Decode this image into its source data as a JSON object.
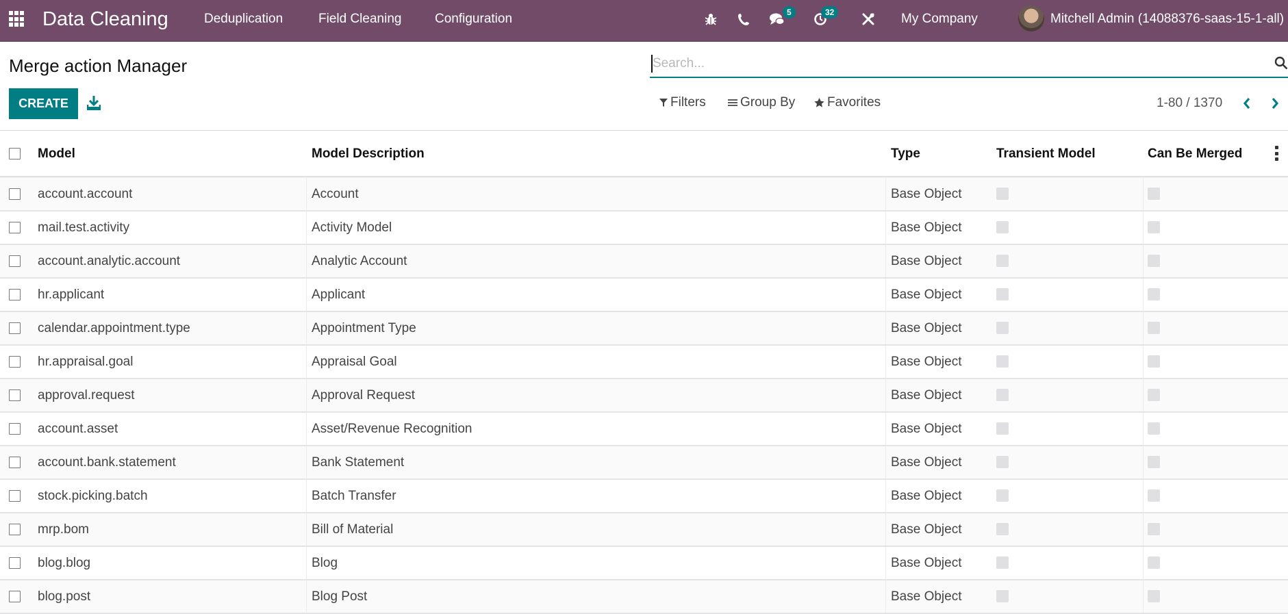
{
  "navbar": {
    "app_name": "Data Cleaning",
    "menu": [
      "Deduplication",
      "Field Cleaning",
      "Configuration"
    ],
    "icons": [
      "bug-icon",
      "phone-icon",
      "chat-icon",
      "activity-clock-icon",
      "tools-icon"
    ],
    "messages_badge": "5",
    "activities_badge": "32",
    "company": "My Company",
    "user": "Mitchell Admin (14088376-saas-15-1-all)"
  },
  "page": {
    "title": "Merge action Manager",
    "create_label": "CREATE"
  },
  "search": {
    "placeholder": "Search...",
    "value": ""
  },
  "filters": {
    "filters_label": "Filters",
    "groupby_label": "Group By",
    "favorites_label": "Favorites"
  },
  "pager": {
    "value": "1-80 / 1370"
  },
  "table": {
    "columns": [
      "Model",
      "Model Description",
      "Type",
      "Transient Model",
      "Can Be Merged"
    ],
    "rows": [
      {
        "model": "account.account",
        "description": "Account",
        "type": "Base Object",
        "transient": false,
        "mergeable": false
      },
      {
        "model": "mail.test.activity",
        "description": "Activity Model",
        "type": "Base Object",
        "transient": false,
        "mergeable": false
      },
      {
        "model": "account.analytic.account",
        "description": "Analytic Account",
        "type": "Base Object",
        "transient": false,
        "mergeable": false
      },
      {
        "model": "hr.applicant",
        "description": "Applicant",
        "type": "Base Object",
        "transient": false,
        "mergeable": false
      },
      {
        "model": "calendar.appointment.type",
        "description": "Appointment Type",
        "type": "Base Object",
        "transient": false,
        "mergeable": false
      },
      {
        "model": "hr.appraisal.goal",
        "description": "Appraisal Goal",
        "type": "Base Object",
        "transient": false,
        "mergeable": false
      },
      {
        "model": "approval.request",
        "description": "Approval Request",
        "type": "Base Object",
        "transient": false,
        "mergeable": false
      },
      {
        "model": "account.asset",
        "description": "Asset/Revenue Recognition",
        "type": "Base Object",
        "transient": false,
        "mergeable": false
      },
      {
        "model": "account.bank.statement",
        "description": "Bank Statement",
        "type": "Base Object",
        "transient": false,
        "mergeable": false
      },
      {
        "model": "stock.picking.batch",
        "description": "Batch Transfer",
        "type": "Base Object",
        "transient": false,
        "mergeable": false
      },
      {
        "model": "mrp.bom",
        "description": "Bill of Material",
        "type": "Base Object",
        "transient": false,
        "mergeable": false
      },
      {
        "model": "blog.blog",
        "description": "Blog",
        "type": "Base Object",
        "transient": false,
        "mergeable": false
      },
      {
        "model": "blog.post",
        "description": "Blog Post",
        "type": "Base Object",
        "transient": false,
        "mergeable": false
      }
    ]
  },
  "colors": {
    "navbar": "#714b67",
    "primary": "#017e84"
  }
}
